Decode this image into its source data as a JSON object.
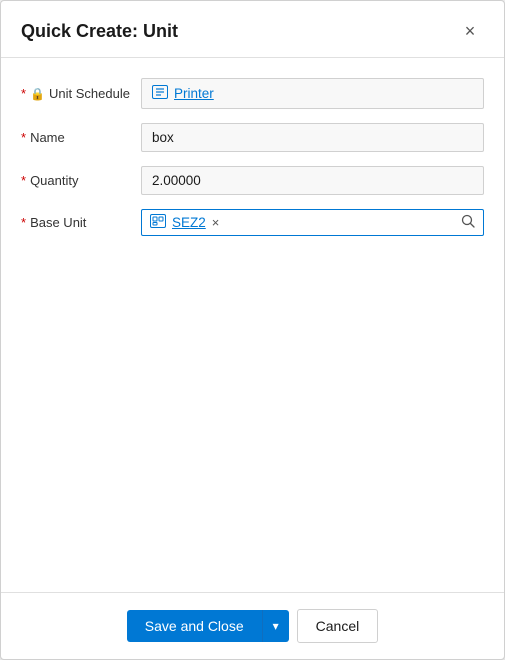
{
  "dialog": {
    "title": "Quick Create: Unit",
    "close_label": "×"
  },
  "fields": {
    "unit_schedule": {
      "label": "Unit Schedule",
      "required": true,
      "locked": true,
      "value": "Printer"
    },
    "name": {
      "label": "Name",
      "required": true,
      "value": "box"
    },
    "quantity": {
      "label": "Quantity",
      "required": true,
      "value": "2.00000"
    },
    "base_unit": {
      "label": "Base Unit",
      "required": true,
      "value": "SEZ2"
    }
  },
  "footer": {
    "save_label": "Save and Close",
    "cancel_label": "Cancel"
  },
  "icons": {
    "close": "✕",
    "lock": "🔒",
    "link": "🔗",
    "tag": "🏷",
    "search": "🔍",
    "dropdown_arrow": "▾"
  }
}
